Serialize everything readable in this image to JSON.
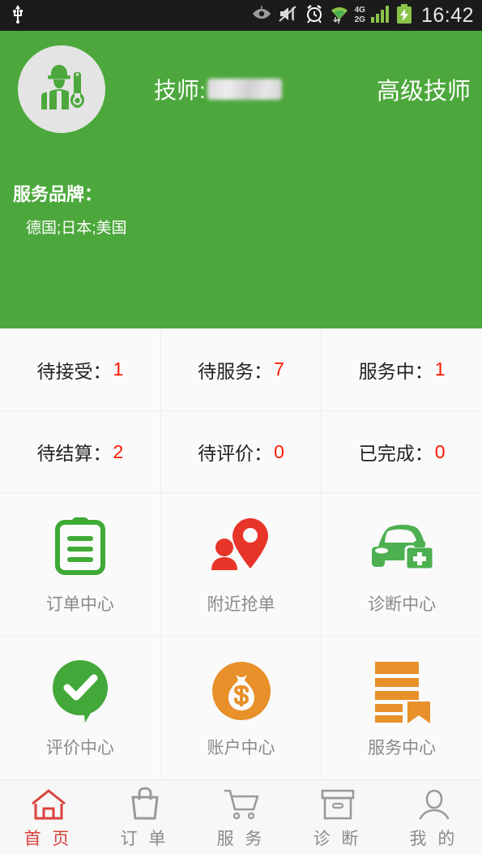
{
  "statusbar": {
    "icons": [
      "usb-icon",
      "eye-icon",
      "mute-icon",
      "alarm-icon",
      "wifi-icon",
      "signal-icon",
      "battery-charging-icon"
    ],
    "network_top": "4G",
    "network_bottom": "2G",
    "clock": "16:42"
  },
  "header": {
    "avatar_icon": "technician-avatar-icon",
    "technician_label": "技师:",
    "technician_name": "",
    "level": "高级技师",
    "brand_label": "服务品牌：",
    "brand_value": "德国;日本;美国",
    "background_color": "#4ca83c"
  },
  "stats": {
    "number_color": "#ff1a00",
    "rows": [
      [
        {
          "label": "待接受：",
          "value": "1"
        },
        {
          "label": "待服务：",
          "value": "7"
        },
        {
          "label": "服务中：",
          "value": "1"
        }
      ],
      [
        {
          "label": "待结算：",
          "value": "2"
        },
        {
          "label": "待评价：",
          "value": "0"
        },
        {
          "label": "已完成：",
          "value": "0"
        }
      ]
    ]
  },
  "menu": {
    "rows": [
      [
        {
          "label": "订单中心",
          "icon": "clipboard-icon",
          "color": "#3faa35"
        },
        {
          "label": "附近抢单",
          "icon": "map-pin-person-icon",
          "color": "#e8352a"
        },
        {
          "label": "诊断中心",
          "icon": "car-medkit-icon",
          "color": "#4caf50"
        }
      ],
      [
        {
          "label": "评价中心",
          "icon": "check-bubble-icon",
          "color": "#43a83a"
        },
        {
          "label": "账户中心",
          "icon": "money-bag-icon",
          "color": "#e8902a"
        },
        {
          "label": "服务中心",
          "icon": "bookmark-list-icon",
          "color": "#e8902a"
        }
      ]
    ]
  },
  "tabbar": {
    "active_color": "#d9423c",
    "inactive_color": "#8a8a8a",
    "items": [
      {
        "label": "首 页",
        "icon": "home-icon",
        "active": true
      },
      {
        "label": "订 单",
        "icon": "shopping-bag-icon",
        "active": false
      },
      {
        "label": "服 务",
        "icon": "shopping-cart-icon",
        "active": false
      },
      {
        "label": "诊 断",
        "icon": "box-icon",
        "active": false
      },
      {
        "label": "我 的",
        "icon": "person-icon",
        "active": false
      }
    ]
  }
}
